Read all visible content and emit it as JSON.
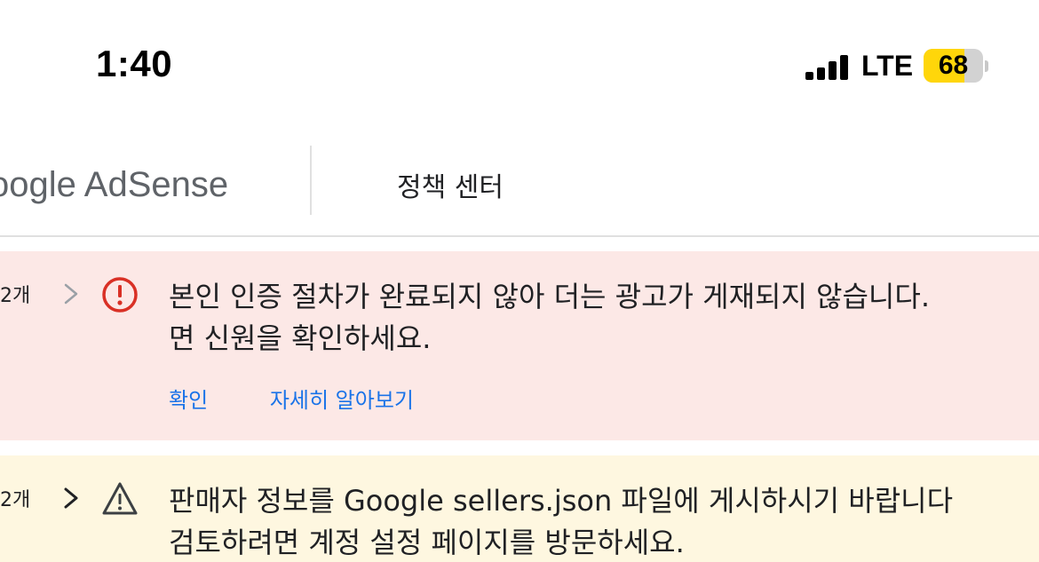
{
  "status_bar": {
    "time": "1:40",
    "network": "LTE",
    "battery_percent": "68",
    "battery_color": "#ffd60a"
  },
  "header": {
    "brand": "oogle AdSense",
    "policy_center": "정책 센터"
  },
  "issues": [
    {
      "severity": "error",
      "icon": "error-circle-icon",
      "count": "2개",
      "message_line1": "본인 인증 절차가 완료되지 않아 더는 광고가 게재되지 않습니다.",
      "message_line2": "면 신원을 확인하세요.",
      "actions": [
        "확인",
        "자세히 알아보기"
      ],
      "background": "#fce8e6",
      "icon_color": "#d93025"
    },
    {
      "severity": "warning",
      "icon": "warning-triangle-icon",
      "count": "2개",
      "message_line1": "판매자 정보를 Google sellers.json 파일에 게시하시기 바랍니다",
      "message_line2": "검토하려면 계정 설정 페이지를 방문하세요.",
      "background": "#fef7e0"
    }
  ],
  "colors": {
    "link": "#1a73e8",
    "text": "#202124"
  }
}
